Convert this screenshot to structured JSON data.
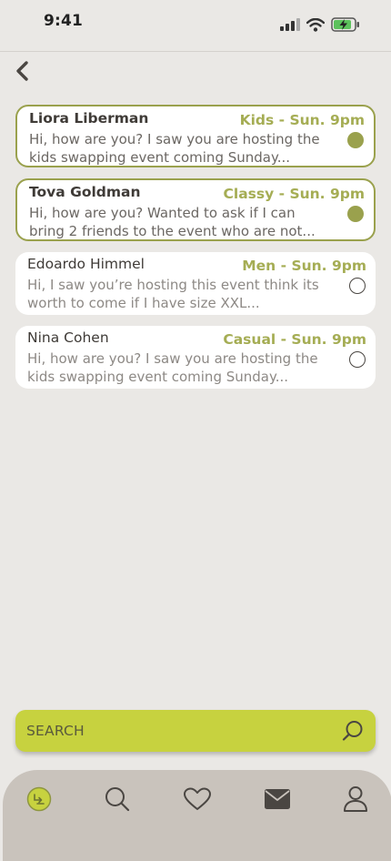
{
  "status_bar": {
    "time": "9:41"
  },
  "messages": [
    {
      "name": "Liora Liberman",
      "tag": "Kids - Sun. 9pm",
      "preview_line1": "Hi, how are you? I saw you are hosting the",
      "preview_line2": "kids swapping event coming Sunday...",
      "unread": true
    },
    {
      "name": "Tova Goldman",
      "tag": "Classy - Sun. 9pm",
      "preview_line1": "Hi, how are you? Wanted to ask if I can",
      "preview_line2": "bring 2 friends to the event who are not...",
      "unread": true
    },
    {
      "name": "Edoardo Himmel",
      "tag": "Men - Sun. 9pm",
      "preview_line1": "Hi, I saw you’re hosting this event think its",
      "preview_line2": "worth to come if I have size XXL...",
      "unread": false
    },
    {
      "name": "Nina Cohen",
      "tag": "Casual - Sun. 9pm",
      "preview_line1": "Hi, how are you? I saw you are hosting the",
      "preview_line2": "kids swapping event coming Sunday...",
      "unread": false
    }
  ],
  "search": {
    "placeholder": "SEARCH"
  },
  "tab_bar": {
    "tabs": [
      {
        "icon": "swap-logo-icon"
      },
      {
        "icon": "search-icon"
      },
      {
        "icon": "heart-icon"
      },
      {
        "icon": "mail-icon",
        "active": true
      },
      {
        "icon": "user-icon"
      }
    ]
  },
  "colors": {
    "background": "#eae8e5",
    "accent_olive": "#9aa14d",
    "tag_green": "#a5ad54",
    "search_lime": "#c7d23f",
    "tab_bar": "#c9c3bc"
  }
}
